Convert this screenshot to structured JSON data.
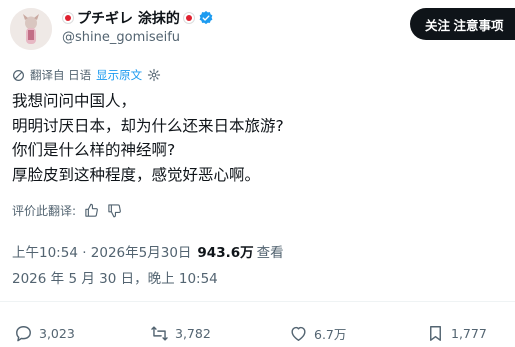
{
  "author": {
    "display_name": "プチギレ 涂抹的",
    "handle": "@shine_gomiseifu",
    "verified": true,
    "flag_color": "#e0202f"
  },
  "follow_button": {
    "label": "关注 注意事项"
  },
  "translation": {
    "label": "翻译自 日语",
    "show_original": "显示原文"
  },
  "tweet": {
    "lines": [
      "我想问问中国人，",
      "明明讨厌日本，却为什么还来日本旅游?",
      "你们是什么样的神经啊?",
      "厚脸皮到这种程度，感觉好恶心啊。"
    ]
  },
  "rate_translation": {
    "label": "评价此翻译:"
  },
  "meta": {
    "timestamp": "上午10:54 · 2026年5月30日",
    "views_count": "943.6万",
    "views_label": "查看",
    "translated_time": "2026 年 5 月 30 日，晚上 10:54"
  },
  "actions": {
    "replies": "3,023",
    "retweets": "3,782",
    "likes": "6.7万",
    "bookmarks": "1,777"
  },
  "colors": {
    "text": "#0f1419",
    "secondary": "#536471",
    "link": "#1d9bf0",
    "verified": "#1d9bf0"
  },
  "icons": [
    "avatar",
    "flag-icon",
    "verified-badge-icon",
    "translate-icon",
    "gear-icon",
    "thumbs-up-icon",
    "thumbs-down-icon",
    "reply-icon",
    "retweet-icon",
    "like-icon",
    "bookmark-icon"
  ]
}
